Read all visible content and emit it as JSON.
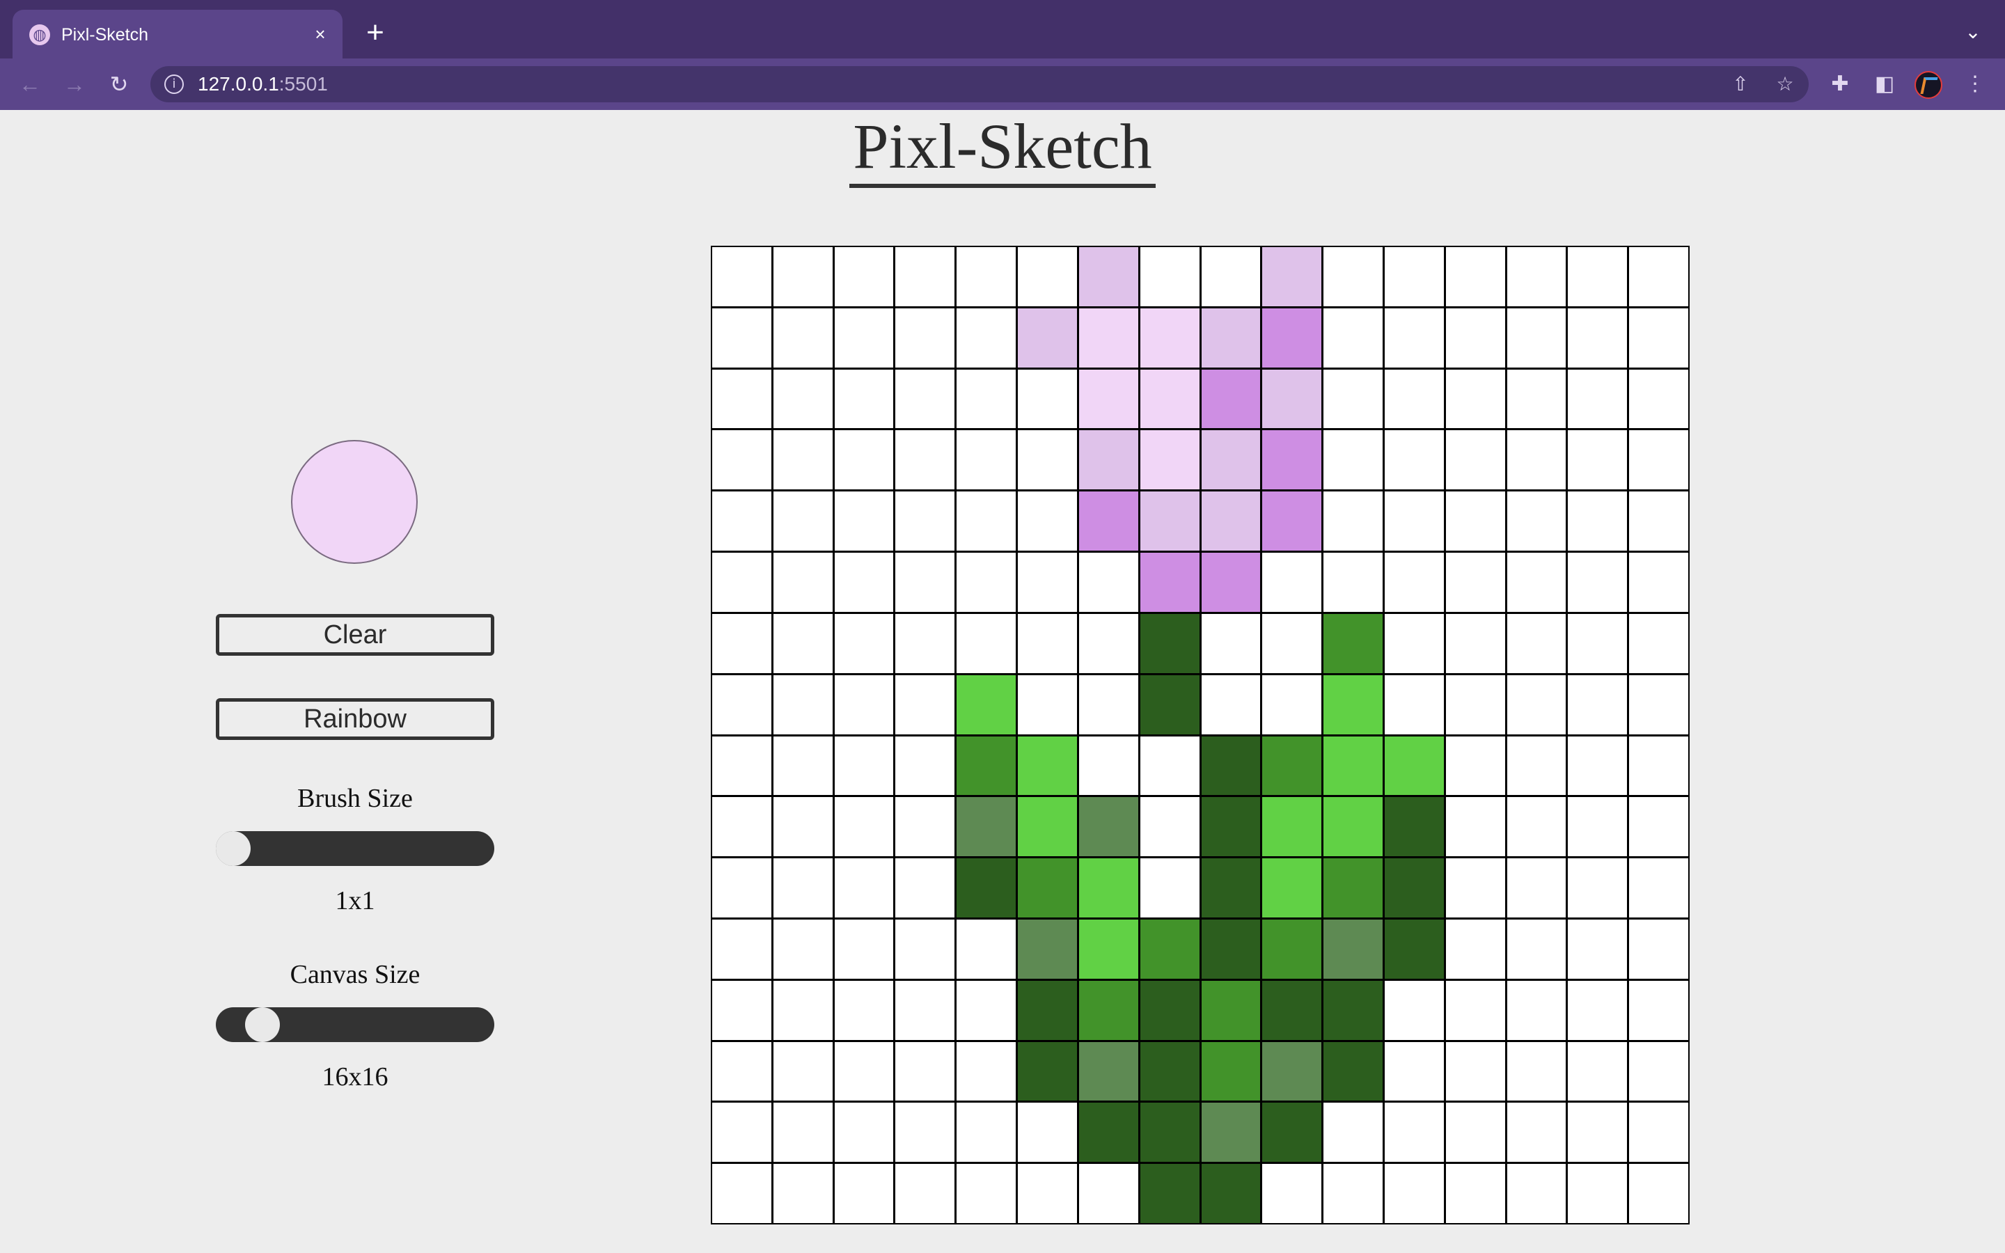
{
  "browser": {
    "tab_title": "Pixl-Sketch",
    "tab_favicon": "globe-icon",
    "tab_close": "×",
    "new_tab": "+",
    "url_host": "127.0.0.1",
    "url_port": ":5501",
    "colors": {
      "tabbar": "#433069",
      "toolbar": "#5b458a",
      "omnibox": "#44346b"
    }
  },
  "page": {
    "title": "Pixl-Sketch",
    "background": "#ededed"
  },
  "controls": {
    "current_color": "#f1d6f7",
    "clear_label": "Clear",
    "rainbow_label": "Rainbow",
    "brush_size_label": "Brush Size",
    "brush_size_value": "1x1",
    "brush_slider_fraction": 0.0,
    "canvas_size_label": "Canvas Size",
    "canvas_size_value": "16x16",
    "canvas_slider_fraction": 0.12
  },
  "canvas": {
    "columns": 16,
    "rows": 16,
    "palette": {
      ".": "#ffffff",
      "a": "#dfc2ea",
      "b": "#f1d6f7",
      "c": "#ce8ee3",
      "d": "#2c5e1e",
      "e": "#42932a",
      "f": "#61d145",
      "g": "#5e8a53",
      "h": "#3b7a27"
    },
    "pixels": [
      "......a..a......",
      ".....abbac......",
      "......bbca......",
      "......abac......",
      "......caac......",
      ".......cc.......",
      ".......d..e.....",
      "....f..d..f.....",
      "....ef..deff....",
      "....gfg.dffd....",
      "....def.dfed....",
      ".....gfedegd....",
      ".....dededd.....",
      ".....dgdegd.....",
      "......ddgd......",
      ".......dd......."
    ]
  }
}
